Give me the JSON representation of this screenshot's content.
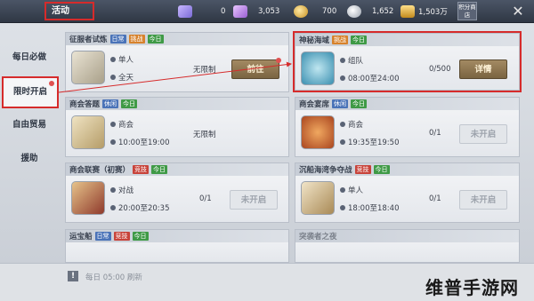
{
  "header": {
    "title": "活动",
    "resources": [
      {
        "icon": "purple-gem-icon",
        "value": "0"
      },
      {
        "icon": "violet-gem-icon",
        "value": "3,053"
      },
      {
        "icon": "gold-coin-icon",
        "value": "700"
      },
      {
        "icon": "silver-coin-icon",
        "value": "1,652"
      },
      {
        "icon": "gold-ingot-icon",
        "value": "1,503万"
      }
    ],
    "score_shop_label": "积分商店"
  },
  "sidebar": {
    "items": [
      {
        "label": "每日必做"
      },
      {
        "label": "限时开启"
      },
      {
        "label": "自由贸易"
      },
      {
        "label": "援助"
      }
    ]
  },
  "activities": [
    {
      "title": "征服者试炼",
      "tags": [
        "日常",
        "挑战",
        "今日"
      ],
      "type": "单人",
      "time": "全天",
      "limit": "无限制",
      "count": "",
      "button": "前往"
    },
    {
      "title": "神秘海域",
      "tags": [
        "挑战",
        "今日"
      ],
      "type": "组队",
      "time": "08:00至24:00",
      "limit": "",
      "count": "0/500",
      "button": "详情"
    },
    {
      "title": "商会答题",
      "tags": [
        "休闲",
        "今日"
      ],
      "type": "商会",
      "time": "10:00至19:00",
      "limit": "无限制",
      "count": "",
      "button": ""
    },
    {
      "title": "商会宴席",
      "tags": [
        "休闲",
        "今日"
      ],
      "type": "商会",
      "time": "19:35至19:50",
      "limit": "",
      "count": "0/1",
      "button": "未开启"
    },
    {
      "title": "商会联赛（初赛）",
      "tags": [
        "竞技",
        "今日"
      ],
      "type": "对战",
      "time": "20:00至20:35",
      "limit": "",
      "count": "0/1",
      "button": "未开启"
    },
    {
      "title": "沉船海湾争夺战",
      "tags": [
        "竞技",
        "今日"
      ],
      "type": "单人",
      "time": "18:00至18:40",
      "limit": "",
      "count": "0/1",
      "button": "未开启"
    },
    {
      "title": "运宝船",
      "tags": [
        "日常",
        "竞技",
        "今日"
      ]
    },
    {
      "title": "突袭者之夜"
    }
  ],
  "footer": {
    "text": "每日 05:00 刷新"
  },
  "watermark": "维普手游网",
  "colors": {
    "highlight": "#d62b2b",
    "tag_daily": "#4a73b8",
    "tag_challenge": "#d7822c",
    "tag_today": "#3f9a46",
    "tag_pvp": "#c8433a"
  }
}
